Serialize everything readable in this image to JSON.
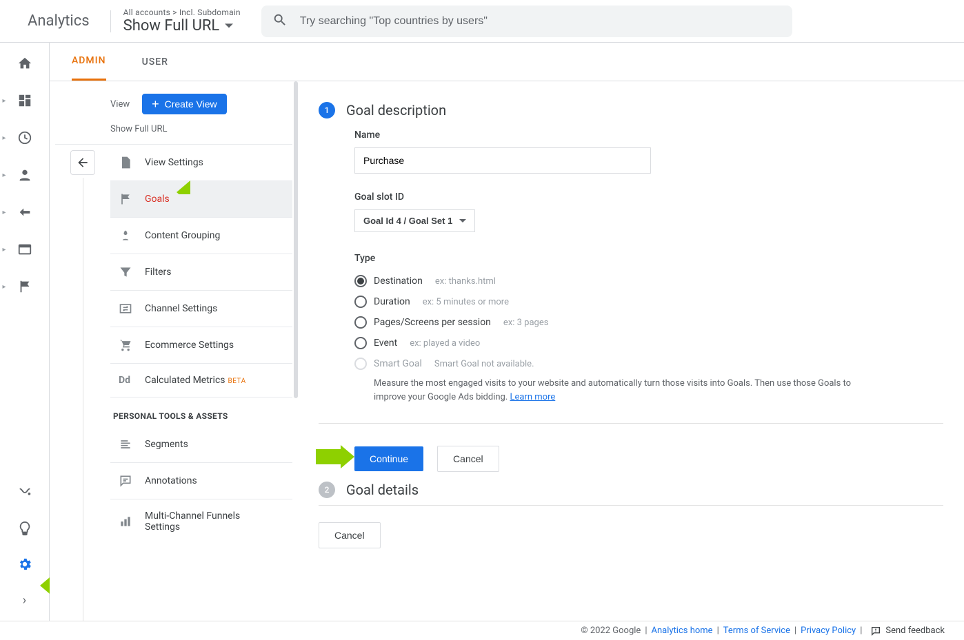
{
  "app": {
    "name": "Analytics"
  },
  "breadcrumb": {
    "top": "All accounts > Incl. Subdomain",
    "main": "Show Full URL"
  },
  "search": {
    "placeholder": "Try searching \"Top countries by users\""
  },
  "tabs": {
    "admin": "ADMIN",
    "user": "USER"
  },
  "view_col": {
    "label": "View",
    "create_btn": "Create View",
    "subtitle": "Show Full URL",
    "items": [
      {
        "label": "View Settings"
      },
      {
        "label": "Goals"
      },
      {
        "label": "Content Grouping"
      },
      {
        "label": "Filters"
      },
      {
        "label": "Channel Settings"
      },
      {
        "label": "Ecommerce Settings"
      },
      {
        "label": "Calculated Metrics",
        "beta": "BETA"
      }
    ],
    "section": "PERSONAL TOOLS & ASSETS",
    "items2": [
      {
        "label": "Segments"
      },
      {
        "label": "Annotations"
      },
      {
        "label": "Multi-Channel Funnels Settings"
      }
    ]
  },
  "form": {
    "step1_title": "Goal description",
    "name_label": "Name",
    "name_value": "Purchase",
    "slot_label": "Goal slot ID",
    "slot_value": "Goal Id 4 / Goal Set 1",
    "type_label": "Type",
    "types": [
      {
        "label": "Destination",
        "hint": "ex: thanks.html"
      },
      {
        "label": "Duration",
        "hint": "ex: 5 minutes or more"
      },
      {
        "label": "Pages/Screens per session",
        "hint": "ex: 3 pages"
      },
      {
        "label": "Event",
        "hint": "ex: played a video"
      }
    ],
    "smart_label": "Smart Goal",
    "smart_hint": "Smart Goal not available.",
    "smart_desc": "Measure the most engaged visits to your website and automatically turn those visits into Goals. Then use those Goals to improve your Google Ads bidding.",
    "learn_more": "Learn more",
    "continue": "Continue",
    "cancel": "Cancel",
    "step2_title": "Goal details"
  },
  "footer": {
    "copyright": "© 2022 Google",
    "home": "Analytics home",
    "tos": "Terms of Service",
    "privacy": "Privacy Policy",
    "feedback": "Send feedback"
  }
}
